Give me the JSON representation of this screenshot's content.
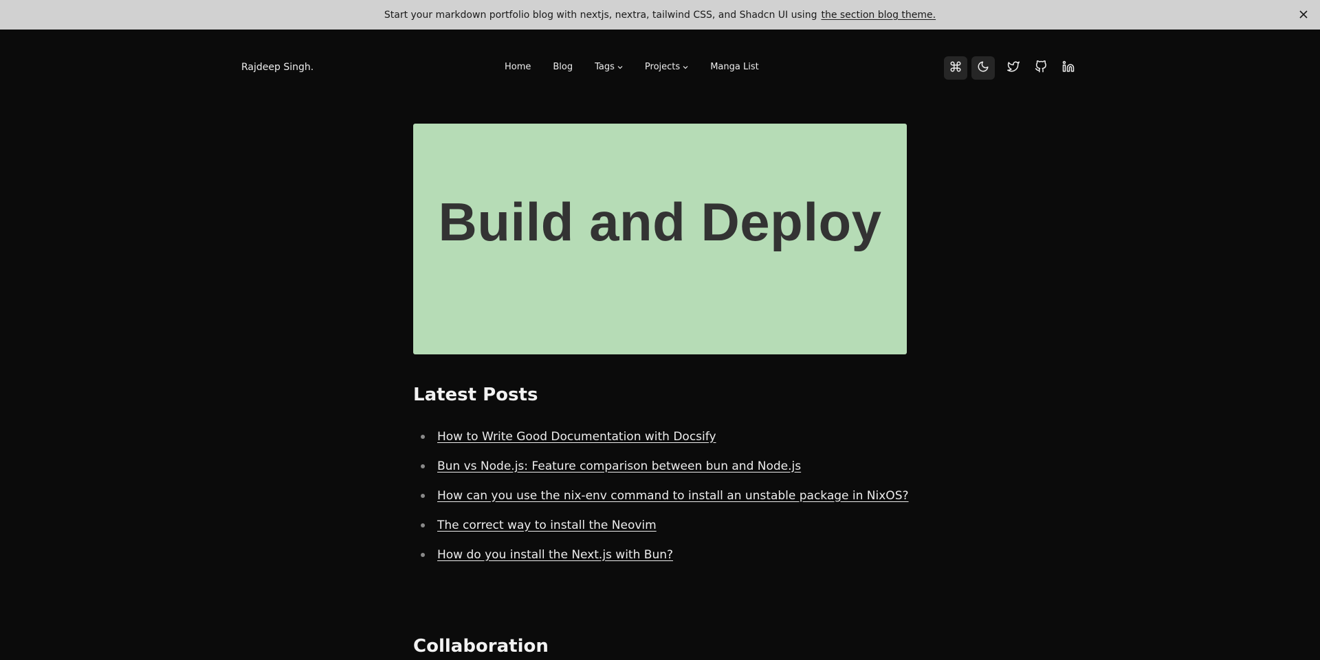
{
  "banner": {
    "text": "Start your markdown portfolio blog with nextjs, nextra, tailwind CSS, and Shadcn UI using",
    "link": "the section blog theme.",
    "close_icon": "close-icon"
  },
  "header": {
    "brand": "Rajdeep Singh.",
    "nav": [
      {
        "label": "Home"
      },
      {
        "label": "Blog"
      },
      {
        "label": "Tags"
      },
      {
        "label": "Projects"
      },
      {
        "label": "Manga List"
      }
    ],
    "icons": [
      "command-icon",
      "moon-icon",
      "twitter-icon",
      "github-icon",
      "linkedin-icon"
    ]
  },
  "hero": {
    "title": "Build and Deploy",
    "background": "#b6dcb6"
  },
  "latest_posts": {
    "title": "Latest Posts",
    "items": [
      "How to Write Good Documentation with Docsify",
      "Bun vs Node.js: Feature comparison between bun and Node.js",
      "How can you use the nix-env command to install an unstable package in NixOS?",
      "The correct way to install the Neovim",
      "How do you install the Next.js with Bun?"
    ]
  },
  "collaboration": {
    "title": "Collaboration"
  }
}
